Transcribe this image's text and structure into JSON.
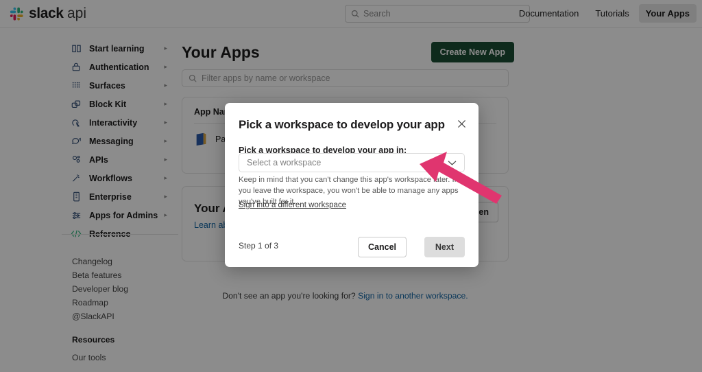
{
  "header": {
    "brand": "slack",
    "brand_suffix": "api",
    "logo_icon": "slack-hash-icon",
    "search": {
      "placeholder": "Search",
      "value": "",
      "icon": "search-icon"
    },
    "nav": [
      {
        "label": "Documentation",
        "active": false
      },
      {
        "label": "Tutorials",
        "active": false
      },
      {
        "label": "Your Apps",
        "active": true
      }
    ]
  },
  "sidebar": {
    "items": [
      {
        "label": "Start learning",
        "icon": "book-open-icon",
        "chevron": "▸"
      },
      {
        "label": "Authentication",
        "icon": "lock-icon",
        "chevron": "▸"
      },
      {
        "label": "Surfaces",
        "icon": "grid-dots-icon",
        "chevron": "▸"
      },
      {
        "label": "Block Kit",
        "icon": "blocks-icon",
        "chevron": "▸"
      },
      {
        "label": "Interactivity",
        "icon": "cursor-click-icon",
        "chevron": "▸"
      },
      {
        "label": "Messaging",
        "icon": "speech-bubble-icon",
        "chevron": "▸"
      },
      {
        "label": "APIs",
        "icon": "api-nodes-icon",
        "chevron": "▸"
      },
      {
        "label": "Workflows",
        "icon": "magic-wand-icon",
        "chevron": "▸"
      },
      {
        "label": "Enterprise",
        "icon": "building-icon",
        "chevron": "▸"
      },
      {
        "label": "Apps for Admins",
        "icon": "sliders-icon",
        "chevron": "▸"
      },
      {
        "label": "Reference",
        "icon": "code-tags-icon",
        "chevron": ""
      }
    ],
    "footer_links": [
      "Changelog",
      "Beta features",
      "Developer blog",
      "Roadmap",
      "@SlackAPI"
    ],
    "footer_heading": "Resources",
    "footer_links_2": [
      "Our tools"
    ]
  },
  "main": {
    "title": "Your Apps",
    "create_button": "Create New App",
    "filter": {
      "placeholder": "Filter apps by name or workspace",
      "value": "",
      "icon": "search-icon"
    },
    "apps_card": {
      "column_header": "App Name",
      "rows": [
        {
          "name": "Pa",
          "icon": "book-app-icon"
        }
      ]
    },
    "your_card": {
      "title": "Your A",
      "link": "Learn ab",
      "button": "en"
    },
    "bottom_note_prefix": "Don't see an app you're looking for? ",
    "bottom_note_link": "Sign in to another workspace."
  },
  "modal": {
    "title": "Pick a workspace to develop your app",
    "close_icon": "close-icon",
    "field_label": "Pick a workspace to develop your app in:",
    "select": {
      "value": "Select a workspace",
      "chevron_icon": "chevron-down-icon"
    },
    "help_text": "Keep in mind that you can't change this app's workspace later. If you leave the workspace, you won't be able to manage any apps you've built for it.",
    "signin_link": "Sign into a different workspace",
    "step_text": "Step 1 of 3",
    "cancel_button": "Cancel",
    "next_button": "Next"
  },
  "annotation": {
    "arrow_icon": "pointer-arrow-icon",
    "arrow_color": "#e0356f",
    "points_to": "workspace-select-field"
  },
  "colors": {
    "brand_green": "#1a4d33",
    "link_blue": "#1264a3",
    "text_primary": "#1d1c1d",
    "scrim": "rgba(0,0,0,0.45)",
    "annotation_pink": "#e0356f"
  }
}
